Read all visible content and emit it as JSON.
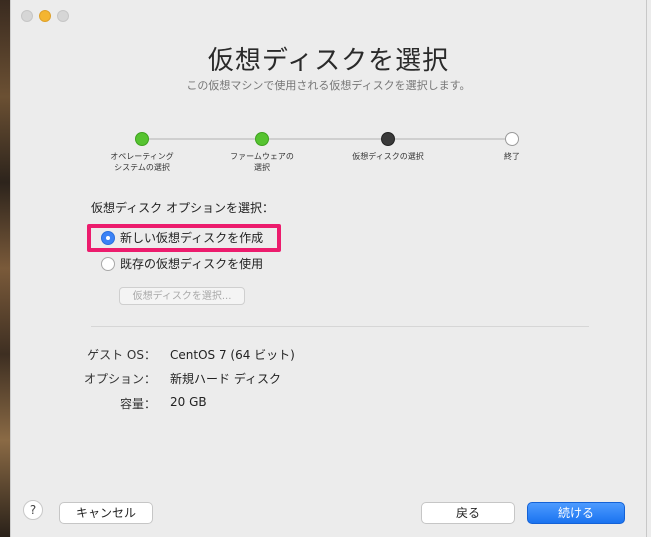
{
  "title": "仮想ディスクを選択",
  "subtitle": "この仮想マシンで使用される仮想ディスクを選択します。",
  "steps": [
    {
      "label": "オペレーティング\nシステムの選択",
      "state": "done"
    },
    {
      "label": "ファームウェアの\n選択",
      "state": "done"
    },
    {
      "label": "仮想ディスクの選択",
      "state": "current"
    },
    {
      "label": "終了",
      "state": "todo"
    }
  ],
  "options": {
    "heading": "仮想ディスク オプションを選択：",
    "create_new": "新しい仮想ディスクを作成",
    "use_existing": "既存の仮想ディスクを使用",
    "choose_disk_button": "仮想ディスクを選択...",
    "selected": "create_new"
  },
  "info": [
    {
      "key": "ゲスト OS：",
      "value": "CentOS 7 (64 ビット)"
    },
    {
      "key": "オプション：",
      "value": "新規ハード ディスク"
    },
    {
      "key": "容量：",
      "value": "20 GB"
    }
  ],
  "footer": {
    "help": "?",
    "cancel": "キャンセル",
    "back": "戻る",
    "continue": "続ける"
  },
  "colors": {
    "done": "#56c330",
    "current": "#3a3a3a",
    "highlight": "#ec1c6d",
    "primary": "#1a73f0"
  }
}
